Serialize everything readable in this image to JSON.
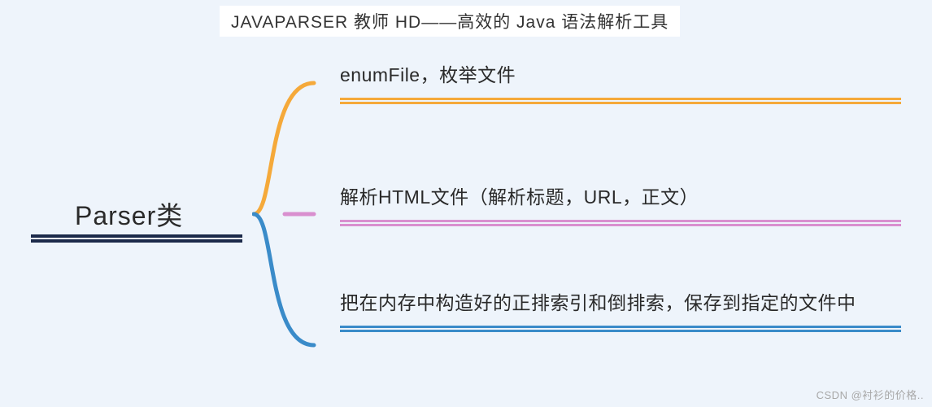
{
  "title": "JAVAPARSER 教师 HD——高效的 Java 语法解析工具",
  "root": {
    "label": "Parser类"
  },
  "children": [
    {
      "label": "enumFile，枚举文件"
    },
    {
      "label": "解析HTML文件（解析标题，URL，正文）"
    },
    {
      "label": "把在内存中构造好的正排索引和倒排索，保存到指定的文件中"
    }
  ],
  "watermark": "CSDN @衬衫的价格.."
}
